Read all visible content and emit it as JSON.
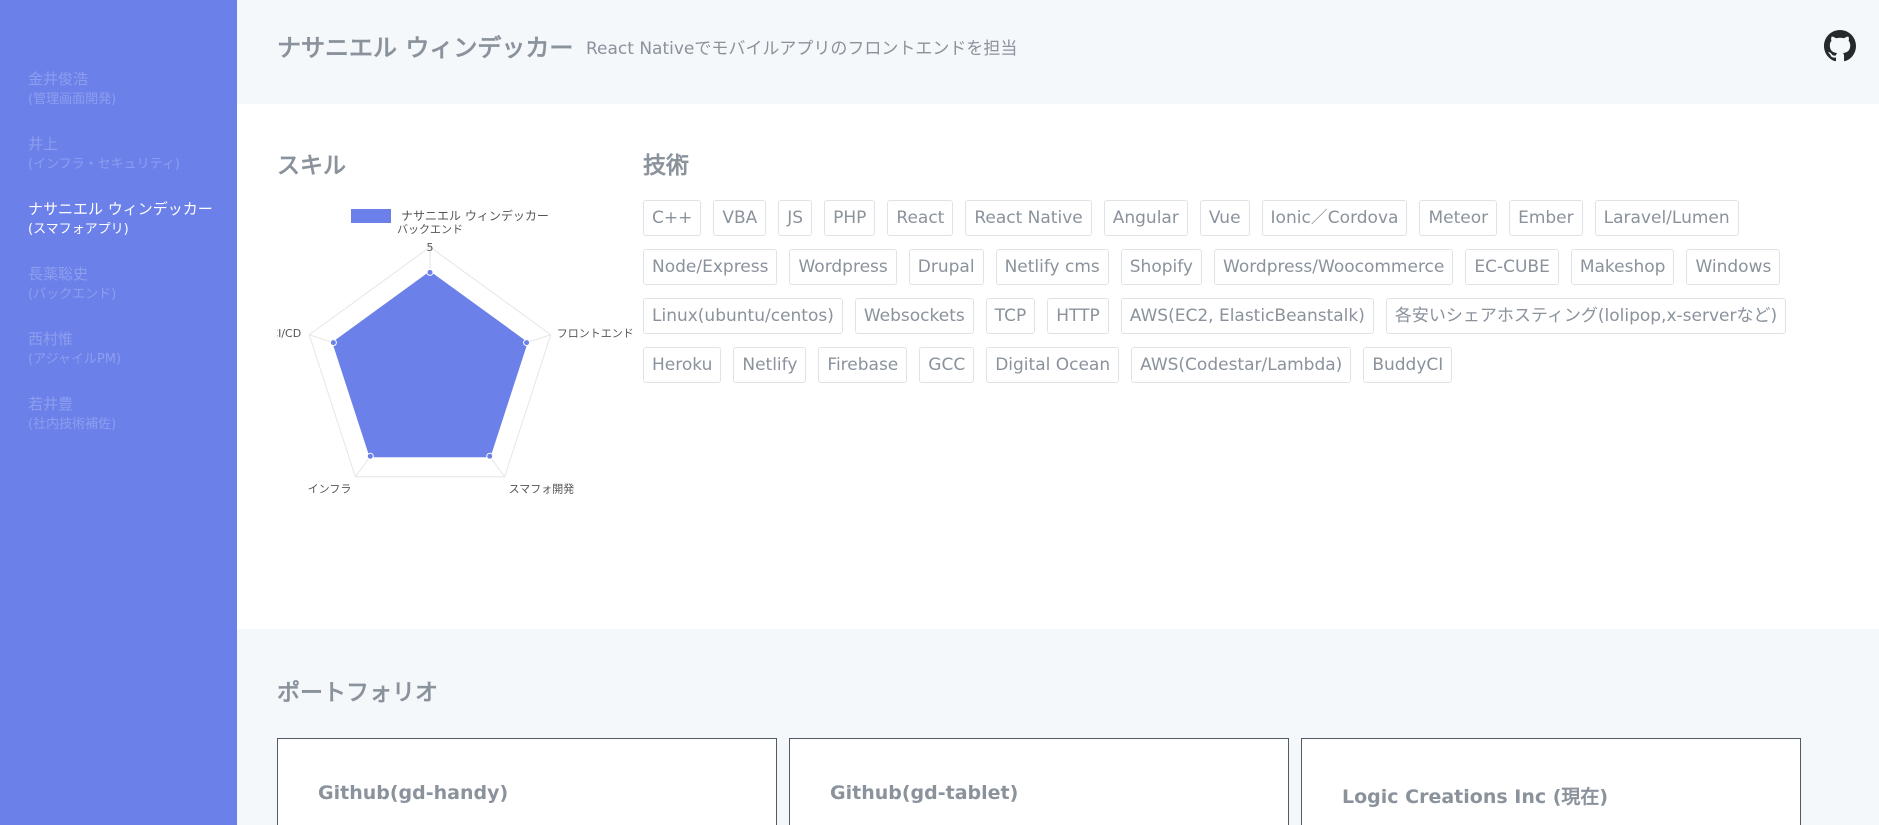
{
  "sidebar": {
    "items": [
      {
        "name": "金井俊浩",
        "role": "(管理画面開発)"
      },
      {
        "name": "井上",
        "role": "(インフラ・セキュリティ)"
      },
      {
        "name": "ナサニエル ウィンデッカー",
        "role": "(スマフォアプリ)"
      },
      {
        "name": "長薬聡史",
        "role": "(バックエンド)"
      },
      {
        "name": "西村惟",
        "role": "(アジャイルPM)"
      },
      {
        "name": "若井豊",
        "role": "(社内技術補佐)"
      }
    ],
    "active_index": 2,
    "color": "#6b80e8"
  },
  "header": {
    "name": "ナサニエル ウィンデッカー",
    "subtitle": "React Nativeでモバイルアプリのフロントエンドを担当",
    "github_icon": "github-icon"
  },
  "skills": {
    "title": "スキル"
  },
  "chart_data": {
    "type": "radar",
    "legend": "ナサニエル ウィンデッカー",
    "legend_placement": "top",
    "axes": [
      "バックエンド",
      "フロントエンド",
      "スマフォ開発",
      "インフラ",
      "CI/CD"
    ],
    "values": [
      4,
      4,
      4,
      4,
      4
    ],
    "max": 5,
    "tick_labels": [
      "5"
    ],
    "fill_color": "#6b80e8"
  },
  "tech": {
    "title": "技術",
    "tags": [
      "C++",
      "VBA",
      "JS",
      "PHP",
      "React",
      "React Native",
      "Angular",
      "Vue",
      "Ionic／Cordova",
      "Meteor",
      "Ember",
      "Laravel/Lumen",
      "Node/Express",
      "Wordpress",
      "Drupal",
      "Netlify cms",
      "Shopify",
      "Wordpress/Woocommerce",
      "EC-CUBE",
      "Makeshop",
      "Windows",
      "Linux(ubuntu/centos)",
      "Websockets",
      "TCP",
      "HTTP",
      "AWS(EC2, ElasticBeanstalk)",
      "各安いシェアホスティング(lolipop,x-serverなど)",
      "Heroku",
      "Netlify",
      "Firebase",
      "GCC",
      "Digital Ocean",
      "AWS(Codestar/Lambda)",
      "BuddyCI"
    ]
  },
  "portfolio": {
    "title": "ポートフォリオ",
    "cards": [
      {
        "title": "Github(gd-handy)"
      },
      {
        "title": "Github(gd-tablet)"
      },
      {
        "title": "Logic Creations Inc (現在)"
      }
    ]
  }
}
